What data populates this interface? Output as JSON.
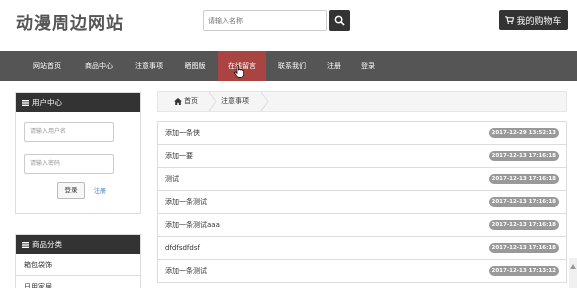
{
  "header": {
    "logo": "动漫周边网站",
    "search_placeholder": "请输入名称",
    "cart_label": "我的购物车"
  },
  "nav": {
    "items": [
      {
        "label": "网站首页"
      },
      {
        "label": "商品中心"
      },
      {
        "label": "注意事项"
      },
      {
        "label": "晒图版"
      },
      {
        "label": "在线留言"
      },
      {
        "label": "联系我们"
      },
      {
        "label": "注册"
      },
      {
        "label": "登录"
      }
    ]
  },
  "user_center": {
    "title": "用户中心",
    "username_placeholder": "请输入用户名",
    "password_placeholder": "请输入密码",
    "login_label": "登录",
    "register_label": "注册"
  },
  "categories": {
    "title": "商品分类",
    "items": [
      "箱包袋饰",
      "日用家居"
    ]
  },
  "breadcrumb": {
    "home": "首页",
    "current": "注意事项"
  },
  "messages": [
    {
      "title": "添加一条侠",
      "date": "2017-12-29 13:52:13"
    },
    {
      "title": "添加一要",
      "date": "2017-12-13 17:16:18"
    },
    {
      "title": "测试",
      "date": "2017-12-13 17:16:18"
    },
    {
      "title": "添加一条测试",
      "date": "2017-12-13 17:16:18"
    },
    {
      "title": "添加一条测试aaa",
      "date": "2017-12-13 17:16:18"
    },
    {
      "title": "dfdfsdfdsf",
      "date": "2017-12-13 17:16:18"
    },
    {
      "title": "添加一条测试",
      "date": "2017-12-13 17:13:12"
    }
  ]
}
